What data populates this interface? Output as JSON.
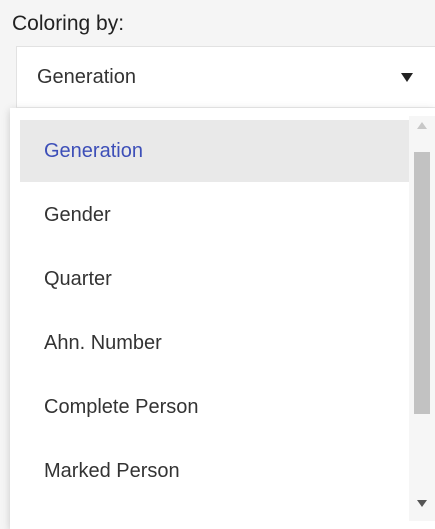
{
  "label": "Coloring by:",
  "select": {
    "value": "Generation",
    "arrow_icon": "triangle-down-icon"
  },
  "dropdown": {
    "options": [
      {
        "label": "Generation",
        "selected": true
      },
      {
        "label": "Gender",
        "selected": false
      },
      {
        "label": "Quarter",
        "selected": false
      },
      {
        "label": "Ahn. Number",
        "selected": false
      },
      {
        "label": "Complete Person",
        "selected": false
      },
      {
        "label": "Marked Person",
        "selected": false
      }
    ]
  },
  "colors": {
    "selected_text": "#3d4fb8",
    "selected_bg": "#e9e9e9",
    "text": "#333333"
  }
}
